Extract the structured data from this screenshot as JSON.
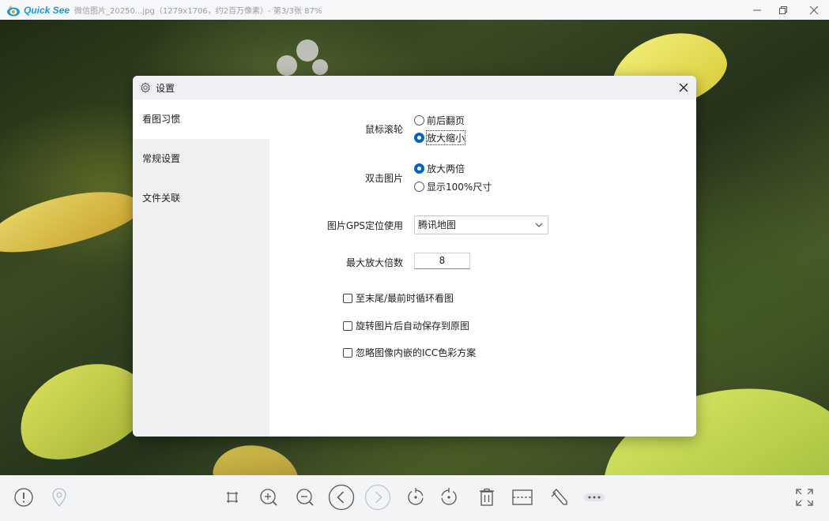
{
  "titlebar": {
    "app_name": "Quick See",
    "file_info": "微信图片_20250...jpg（1279x1706，约2百万像素）- 第3/3张 87%"
  },
  "dialog": {
    "title": "设置",
    "sidebar": [
      {
        "label": "看图习惯",
        "active": true
      },
      {
        "label": "常规设置",
        "active": false
      },
      {
        "label": "文件关联",
        "active": false
      }
    ],
    "mouse_wheel": {
      "label": "鼠标滚轮",
      "options": [
        {
          "label": "前后翻页",
          "checked": false
        },
        {
          "label": "放大缩小",
          "checked": true
        }
      ]
    },
    "double_click": {
      "label": "双击图片",
      "options": [
        {
          "label": "放大两倍",
          "checked": true
        },
        {
          "label": "显示100%尺寸",
          "checked": false
        }
      ]
    },
    "gps": {
      "label": "图片GPS定位使用",
      "selected": "腾讯地图"
    },
    "max_zoom": {
      "label": "最大放大倍数",
      "value": "8"
    },
    "checkboxes": [
      {
        "label": "至末尾/最前时循环看图",
        "checked": false
      },
      {
        "label": "旋转图片后自动保存到原图",
        "checked": false
      },
      {
        "label": "忽略图像内嵌的ICC色彩方案",
        "checked": false
      }
    ]
  },
  "icons": {
    "titlebar": [
      "app-logo-icon",
      "minimize-icon",
      "restore-icon",
      "close-icon"
    ],
    "dialog": [
      "gear-icon",
      "close-icon",
      "chevron-down-icon"
    ],
    "toolbar": [
      "info-icon",
      "location-pin-icon",
      "fit-crop-icon",
      "zoom-in-icon",
      "zoom-out-icon",
      "prev-icon",
      "next-icon",
      "rotate-left-icon",
      "rotate-right-icon",
      "delete-icon",
      "crop-icon",
      "edit-icon",
      "more-icon",
      "fullscreen-icon"
    ]
  },
  "colors": {
    "accent": "#0067c0",
    "brand": "#1a9bd7"
  }
}
